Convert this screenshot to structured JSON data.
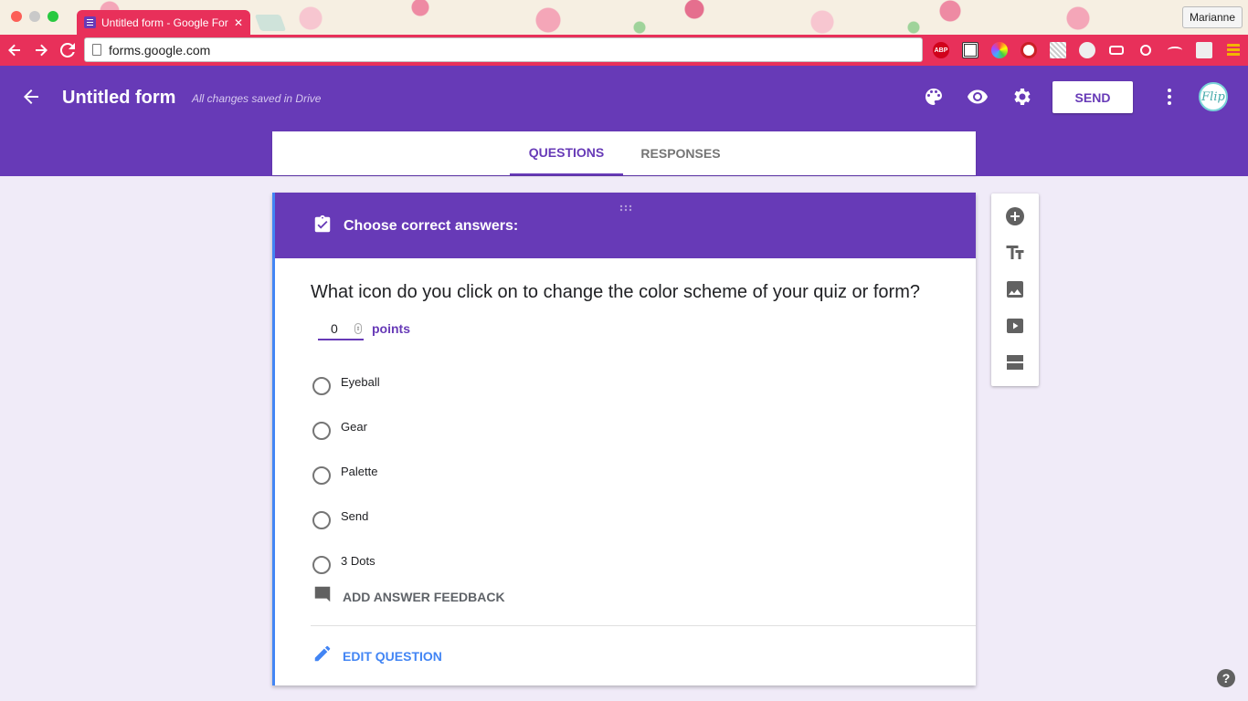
{
  "browser": {
    "tab_title": "Untitled form - Google Forms",
    "tab_close": "✕",
    "url": "forms.google.com",
    "profile_name": "Marianne",
    "extensions": [
      "abp-icon",
      "qr-icon",
      "color-picker-icon",
      "pinterest-icon",
      "qr-code-icon",
      "emoji-icon",
      "link-icon",
      "search-zoom-icon",
      "edit-icon",
      "slash-icon",
      "menu-icon"
    ],
    "abp_label": "ABP"
  },
  "header": {
    "title": "Untitled form",
    "saved_status": "All changes saved in Drive",
    "send_label": "SEND",
    "avatar_text": "Flip"
  },
  "tabs": {
    "questions": "QUESTIONS",
    "responses": "RESPONSES"
  },
  "question_card": {
    "banner": "Choose correct answers:",
    "question": "What icon do you click on to change the color scheme of your quiz or form?",
    "points_value": "0",
    "points_label": "points",
    "options": [
      "Eyeball",
      "Gear",
      "Palette",
      "Send",
      "3 Dots"
    ],
    "feedback_label": "ADD ANSWER FEEDBACK",
    "edit_label": "EDIT QUESTION"
  },
  "help": "?",
  "colors": {
    "primary": "#673ab7",
    "accent": "#4285f4",
    "browser_toolbar": "#e8305a",
    "background": "#f0ebf8"
  }
}
